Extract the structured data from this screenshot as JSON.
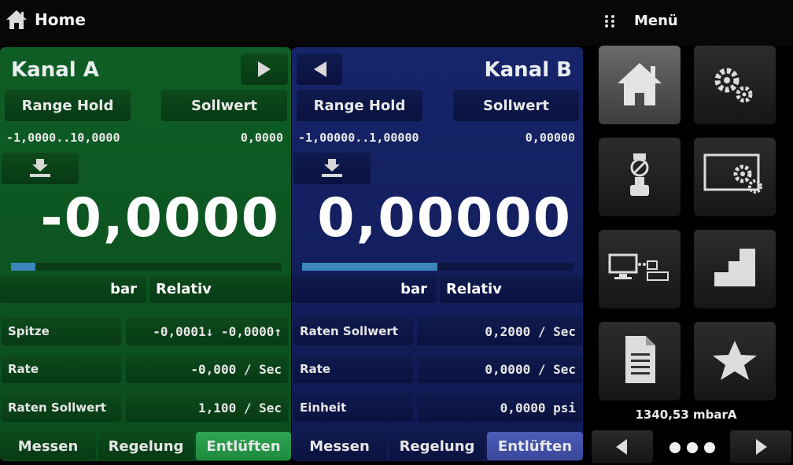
{
  "header": {
    "title": "Home",
    "menu_label": "Menü"
  },
  "channel_a": {
    "title": "Kanal A",
    "range_hold": "Range Hold",
    "setpoint_btn": "Sollwert",
    "range": "-1,0000..10,0000",
    "setpoint_value": "0,0000",
    "reading": "-0,0000",
    "bar_fraction": 0.09,
    "unit": "bar",
    "mode": "Relativ",
    "rows": [
      {
        "label": "Spitze",
        "value": "-0,0001↓  -0,0000↑"
      },
      {
        "label": "Rate",
        "value": "-0,000 / Sec"
      },
      {
        "label": "Raten Sollwert",
        "value": "1,100 / Sec"
      }
    ],
    "tabs": [
      "Messen",
      "Regelung",
      "Entlüften"
    ],
    "active_tab": 2
  },
  "channel_b": {
    "title": "Kanal B",
    "range_hold": "Range Hold",
    "setpoint_btn": "Sollwert",
    "range": "-1,00000..1,00000",
    "setpoint_value": "0,00000",
    "reading": "0,00000",
    "bar_fraction": 0.5,
    "unit": "bar",
    "mode": "Relativ",
    "rows": [
      {
        "label": "Raten Sollwert",
        "value": "0,2000 / Sec"
      },
      {
        "label": "Rate",
        "value": "0,0000 / Sec"
      },
      {
        "label": "Einheit",
        "value": "0,0000 psi"
      }
    ],
    "tabs": [
      "Messen",
      "Regelung",
      "Entlüften"
    ],
    "active_tab": 2
  },
  "sidebar": {
    "tiles": [
      "home-icon",
      "settings-gears-icon",
      "regulator-icon",
      "display-settings-icon",
      "monitor-network-icon",
      "step-chart-icon",
      "document-icon",
      "favorite-star-icon"
    ],
    "barometer": "1340,53 mbarA"
  },
  "colors": {
    "green_panel": "#0f5e25",
    "blue_panel": "#16246a",
    "bar_fill": "#3a86bd"
  }
}
